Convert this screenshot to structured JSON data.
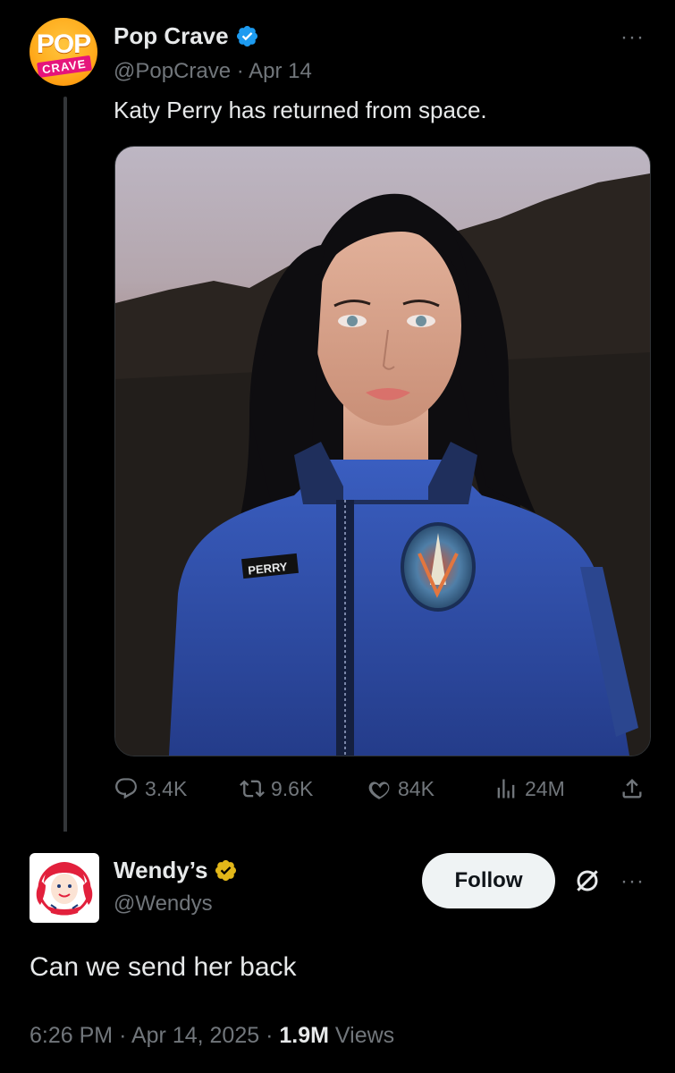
{
  "tweet1": {
    "display_name": "Pop Crave",
    "handle": "@PopCrave",
    "date": "Apr 14",
    "separator": "·",
    "text": "Katy Perry has returned from space.",
    "avatar_text_top": "POP",
    "avatar_text_bottom": "CRAVE",
    "more": "···",
    "media_label": "PERRY",
    "actions": {
      "replies": "3.4K",
      "reposts": "9.6K",
      "likes": "84K",
      "views": "24M"
    }
  },
  "tweet2": {
    "display_name": "Wendy’s",
    "handle": "@Wendys",
    "follow_label": "Follow",
    "more": "···",
    "text": "Can we send her back",
    "time": "6:26 PM",
    "date": "Apr 14, 2025",
    "views_count": "1.9M",
    "views_label": "Views"
  },
  "colors": {
    "background": "#000000",
    "text_primary": "#e7e9ea",
    "text_secondary": "#71767b",
    "verified_blue": "#1d9bf0",
    "verified_gold": "#e2b719",
    "follow_bg": "#eff3f4"
  },
  "icons": [
    "verified-badge-icon",
    "more-icon",
    "reply-icon",
    "repost-icon",
    "like-icon",
    "views-icon",
    "share-icon",
    "grok-icon"
  ]
}
